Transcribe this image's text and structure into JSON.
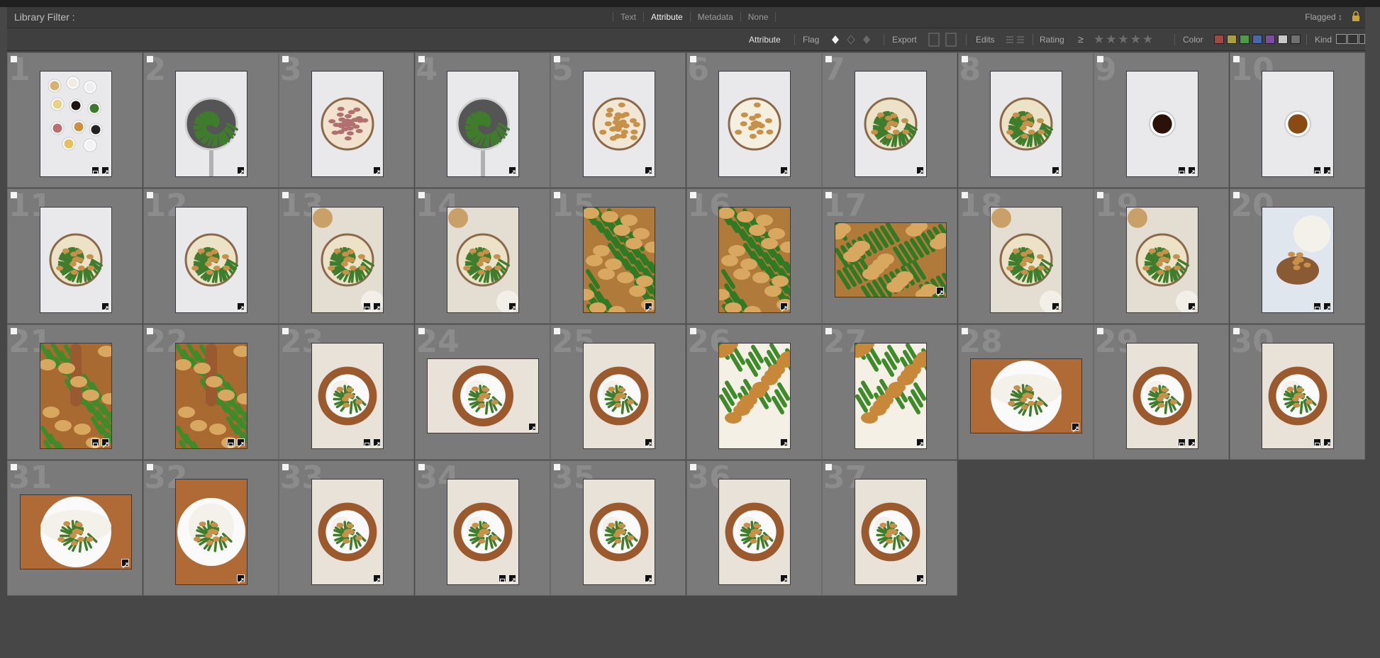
{
  "filter": {
    "title": "Library Filter :",
    "modes": [
      {
        "label": "Text",
        "active": false
      },
      {
        "label": "Attribute",
        "active": true
      },
      {
        "label": "Metadata",
        "active": false
      },
      {
        "label": "None",
        "active": false
      }
    ],
    "preset": "Flagged ↕"
  },
  "attribute": {
    "label": "Attribute",
    "flag_label": "Flag",
    "export_label": "Export",
    "edits_label": "Edits",
    "rating_label": "Rating",
    "rating_op": "≥",
    "color_label": "Color",
    "kind_label": "Kind",
    "swatches": [
      "#a04848",
      "#a8a040",
      "#4e9a48",
      "#4a68a8",
      "#7a4ea0",
      "#c8c8c8",
      "#707070"
    ]
  },
  "photos": [
    {
      "n": "1",
      "orient": "portrait",
      "kind": "ingredients",
      "two_badges": true
    },
    {
      "n": "2",
      "orient": "portrait",
      "kind": "pan-beans",
      "two_badges": false
    },
    {
      "n": "3",
      "orient": "portrait",
      "kind": "pan-meat",
      "two_badges": false
    },
    {
      "n": "4",
      "orient": "portrait",
      "kind": "pan-beans",
      "two_badges": false
    },
    {
      "n": "5",
      "orient": "portrait",
      "kind": "pan-chicken",
      "two_badges": false
    },
    {
      "n": "6",
      "orient": "portrait",
      "kind": "pan-cream",
      "two_badges": false
    },
    {
      "n": "7",
      "orient": "portrait",
      "kind": "pan-mix",
      "two_badges": false
    },
    {
      "n": "8",
      "orient": "portrait",
      "kind": "pan-mix",
      "two_badges": false
    },
    {
      "n": "9",
      "orient": "portrait",
      "kind": "sauce-dark",
      "two_badges": true
    },
    {
      "n": "10",
      "orient": "portrait",
      "kind": "sauce-amber",
      "two_badges": true
    },
    {
      "n": "11",
      "orient": "portrait",
      "kind": "pan-mix",
      "two_badges": false
    },
    {
      "n": "12",
      "orient": "portrait",
      "kind": "pan-mix",
      "two_badges": false
    },
    {
      "n": "13",
      "orient": "portrait",
      "kind": "pan-styled",
      "two_badges": true
    },
    {
      "n": "14",
      "orient": "portrait",
      "kind": "pan-styled",
      "two_badges": false
    },
    {
      "n": "15",
      "orient": "portrait",
      "kind": "closeup",
      "two_badges": false
    },
    {
      "n": "16",
      "orient": "portrait",
      "kind": "closeup",
      "two_badges": false
    },
    {
      "n": "17",
      "orient": "landscape",
      "kind": "closeup",
      "two_badges": false
    },
    {
      "n": "18",
      "orient": "portrait",
      "kind": "pan-styled",
      "two_badges": false
    },
    {
      "n": "19",
      "orient": "portrait",
      "kind": "pan-styled",
      "two_badges": false
    },
    {
      "n": "20",
      "orient": "portrait",
      "kind": "spoon",
      "two_badges": true
    },
    {
      "n": "21",
      "orient": "portrait",
      "kind": "spoon-closeup",
      "two_badges": true
    },
    {
      "n": "22",
      "orient": "portrait",
      "kind": "spoon-closeup",
      "two_badges": true
    },
    {
      "n": "23",
      "orient": "portrait",
      "kind": "plate-board",
      "two_badges": true
    },
    {
      "n": "24",
      "orient": "landscape",
      "kind": "plate-board",
      "two_badges": false
    },
    {
      "n": "25",
      "orient": "portrait",
      "kind": "plate-board",
      "two_badges": false
    },
    {
      "n": "26",
      "orient": "portrait",
      "kind": "plate-closeup",
      "two_badges": false
    },
    {
      "n": "27",
      "orient": "portrait",
      "kind": "plate-closeup",
      "two_badges": false
    },
    {
      "n": "28",
      "orient": "landscape",
      "kind": "plate-rice",
      "two_badges": false
    },
    {
      "n": "29",
      "orient": "portrait",
      "kind": "plate-board",
      "two_badges": true
    },
    {
      "n": "30",
      "orient": "portrait",
      "kind": "plate-board",
      "two_badges": true
    },
    {
      "n": "31",
      "orient": "landscape",
      "kind": "plate-rice",
      "two_badges": false
    },
    {
      "n": "32",
      "orient": "portrait",
      "kind": "plate-rice",
      "two_badges": false
    },
    {
      "n": "33",
      "orient": "portrait",
      "kind": "plate-board",
      "two_badges": false
    },
    {
      "n": "34",
      "orient": "portrait",
      "kind": "plate-board",
      "two_badges": true
    },
    {
      "n": "35",
      "orient": "portrait",
      "kind": "plate-board",
      "two_badges": false
    },
    {
      "n": "36",
      "orient": "portrait",
      "kind": "plate-board",
      "two_badges": false
    },
    {
      "n": "37",
      "orient": "portrait",
      "kind": "plate-board",
      "two_badges": false
    }
  ]
}
